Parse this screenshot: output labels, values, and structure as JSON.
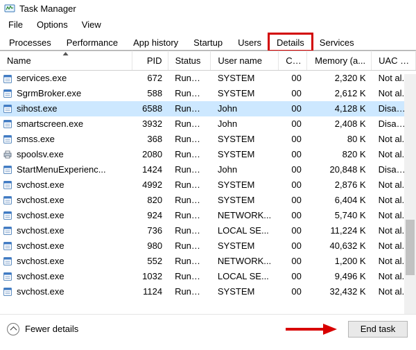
{
  "window": {
    "title": "Task Manager"
  },
  "menu": {
    "items": [
      "File",
      "Options",
      "View"
    ]
  },
  "tabs": {
    "items": [
      "Processes",
      "Performance",
      "App history",
      "Startup",
      "Users",
      "Details",
      "Services"
    ],
    "active": "Details",
    "highlighted": "Details"
  },
  "columns": {
    "name": {
      "label": "Name",
      "sort": true
    },
    "pid": {
      "label": "PID"
    },
    "status": {
      "label": "Status"
    },
    "user": {
      "label": "User name"
    },
    "cpu": {
      "label": "CPU"
    },
    "mem": {
      "label": "Memory (a..."
    },
    "uac": {
      "label": "UAC vi..."
    }
  },
  "rows": [
    {
      "icon": "app",
      "name": "services.exe",
      "pid": "672",
      "status": "Runni...",
      "user": "SYSTEM",
      "cpu": "00",
      "mem": "2,320 K",
      "uac": "Not al..."
    },
    {
      "icon": "app",
      "name": "SgrmBroker.exe",
      "pid": "588",
      "status": "Runni...",
      "user": "SYSTEM",
      "cpu": "00",
      "mem": "2,612 K",
      "uac": "Not al..."
    },
    {
      "icon": "app",
      "name": "sihost.exe",
      "pid": "6588",
      "status": "Runni...",
      "user": "John",
      "cpu": "00",
      "mem": "4,128 K",
      "uac": "Disabl...",
      "selected": true
    },
    {
      "icon": "app",
      "name": "smartscreen.exe",
      "pid": "3932",
      "status": "Runni...",
      "user": "John",
      "cpu": "00",
      "mem": "2,408 K",
      "uac": "Disabl..."
    },
    {
      "icon": "app",
      "name": "smss.exe",
      "pid": "368",
      "status": "Runni...",
      "user": "SYSTEM",
      "cpu": "00",
      "mem": "80 K",
      "uac": "Not al..."
    },
    {
      "icon": "printer",
      "name": "spoolsv.exe",
      "pid": "2080",
      "status": "Runni...",
      "user": "SYSTEM",
      "cpu": "00",
      "mem": "820 K",
      "uac": "Not al..."
    },
    {
      "icon": "app",
      "name": "StartMenuExperienc...",
      "pid": "1424",
      "status": "Runni...",
      "user": "John",
      "cpu": "00",
      "mem": "20,848 K",
      "uac": "Disabl..."
    },
    {
      "icon": "app",
      "name": "svchost.exe",
      "pid": "4992",
      "status": "Runni...",
      "user": "SYSTEM",
      "cpu": "00",
      "mem": "2,876 K",
      "uac": "Not al..."
    },
    {
      "icon": "app",
      "name": "svchost.exe",
      "pid": "820",
      "status": "Runni...",
      "user": "SYSTEM",
      "cpu": "00",
      "mem": "6,404 K",
      "uac": "Not al..."
    },
    {
      "icon": "app",
      "name": "svchost.exe",
      "pid": "924",
      "status": "Runni...",
      "user": "NETWORK...",
      "cpu": "00",
      "mem": "5,740 K",
      "uac": "Not al..."
    },
    {
      "icon": "app",
      "name": "svchost.exe",
      "pid": "736",
      "status": "Runni...",
      "user": "LOCAL SE...",
      "cpu": "00",
      "mem": "11,224 K",
      "uac": "Not al..."
    },
    {
      "icon": "app",
      "name": "svchost.exe",
      "pid": "980",
      "status": "Runni...",
      "user": "SYSTEM",
      "cpu": "00",
      "mem": "40,632 K",
      "uac": "Not al..."
    },
    {
      "icon": "app",
      "name": "svchost.exe",
      "pid": "552",
      "status": "Runni...",
      "user": "NETWORK...",
      "cpu": "00",
      "mem": "1,200 K",
      "uac": "Not al..."
    },
    {
      "icon": "app",
      "name": "svchost.exe",
      "pid": "1032",
      "status": "Runni...",
      "user": "LOCAL SE...",
      "cpu": "00",
      "mem": "9,496 K",
      "uac": "Not al..."
    },
    {
      "icon": "app",
      "name": "svchost.exe",
      "pid": "1124",
      "status": "Runni...",
      "user": "SYSTEM",
      "cpu": "00",
      "mem": "32,432 K",
      "uac": "Not al..."
    }
  ],
  "footer": {
    "fewer": "Fewer details",
    "endtask": "End task"
  }
}
